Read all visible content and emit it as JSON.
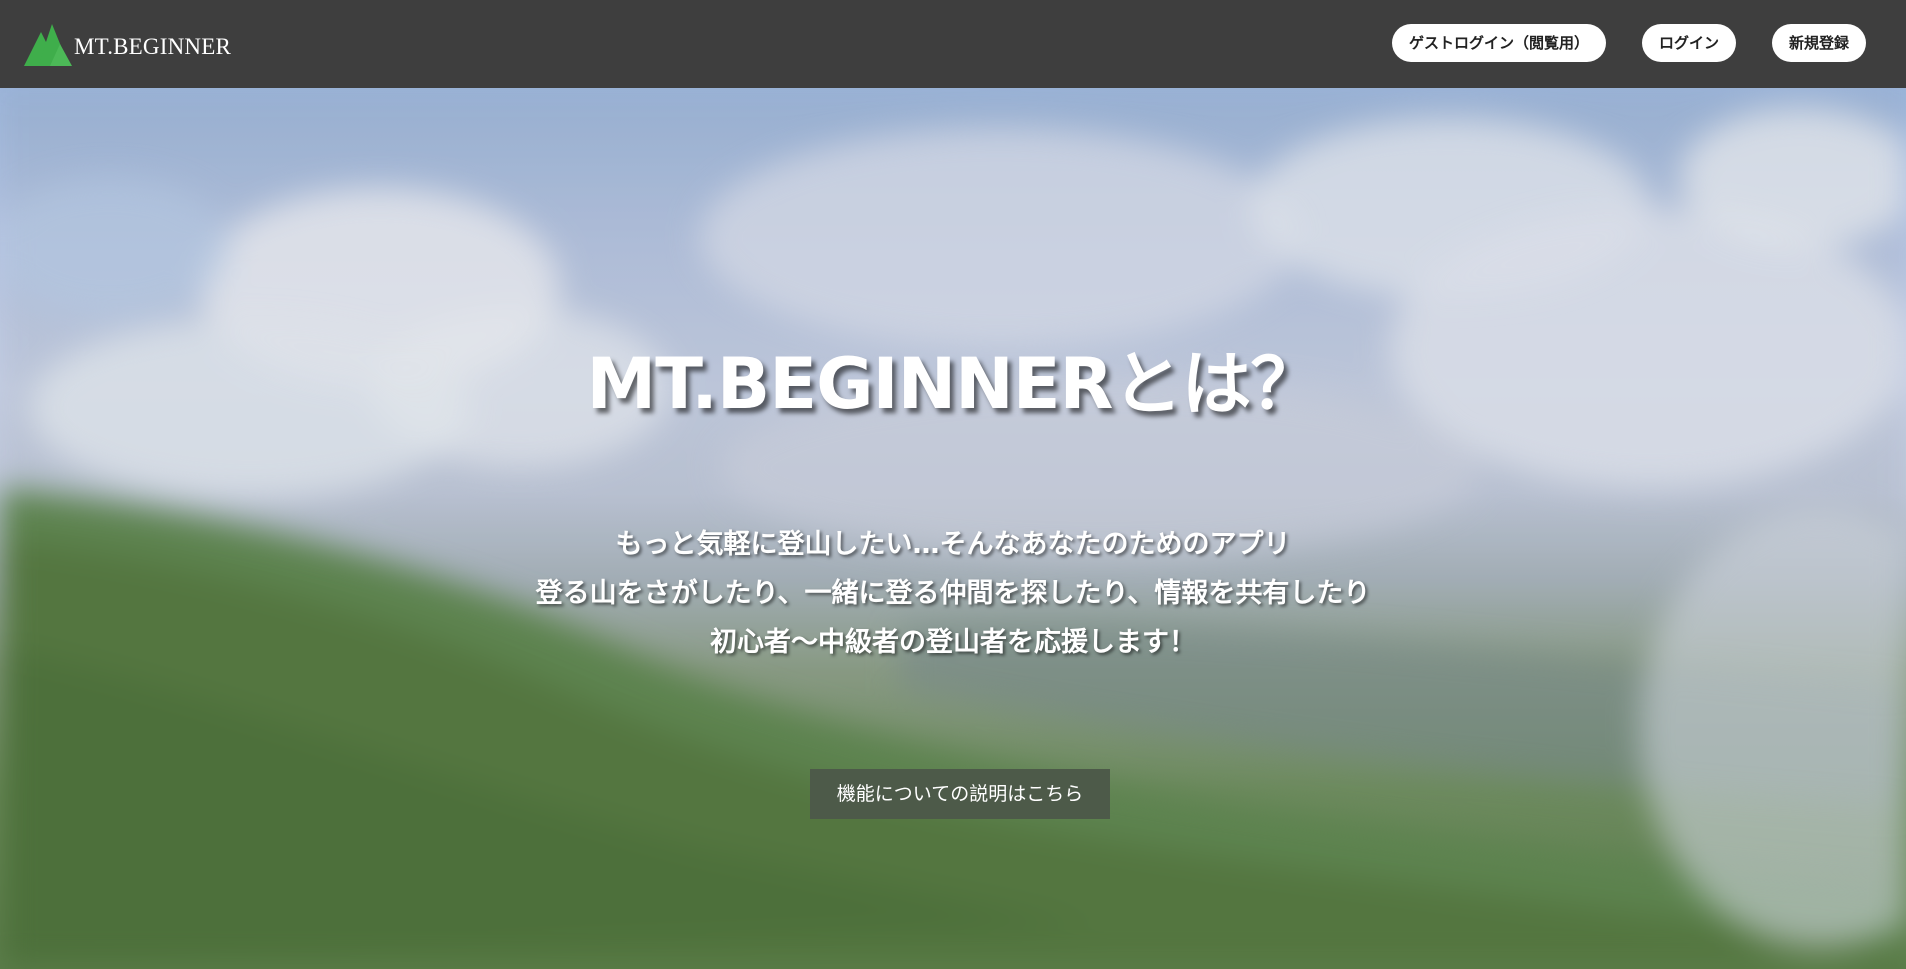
{
  "header": {
    "brand": "MT.BEGINNER",
    "logo_icon": "mountain-icon",
    "logo_color": "#3fae4b",
    "background": "#3e3e3e",
    "nav": {
      "guest_login": "ゲストログイン（閲覧用）",
      "login": "ログイン",
      "signup": "新規登録"
    }
  },
  "hero": {
    "title": "MT.BEGINNERとは？",
    "lines": [
      "もっと気軽に登山したい…そんなあなたのためのアプリ",
      "登る山をさがしたり、一緒に登る仲間を探したり、情報を共有したり",
      "初心者〜中級者の登山者を応援します！"
    ],
    "cta": "機能についての説明はこちら"
  }
}
